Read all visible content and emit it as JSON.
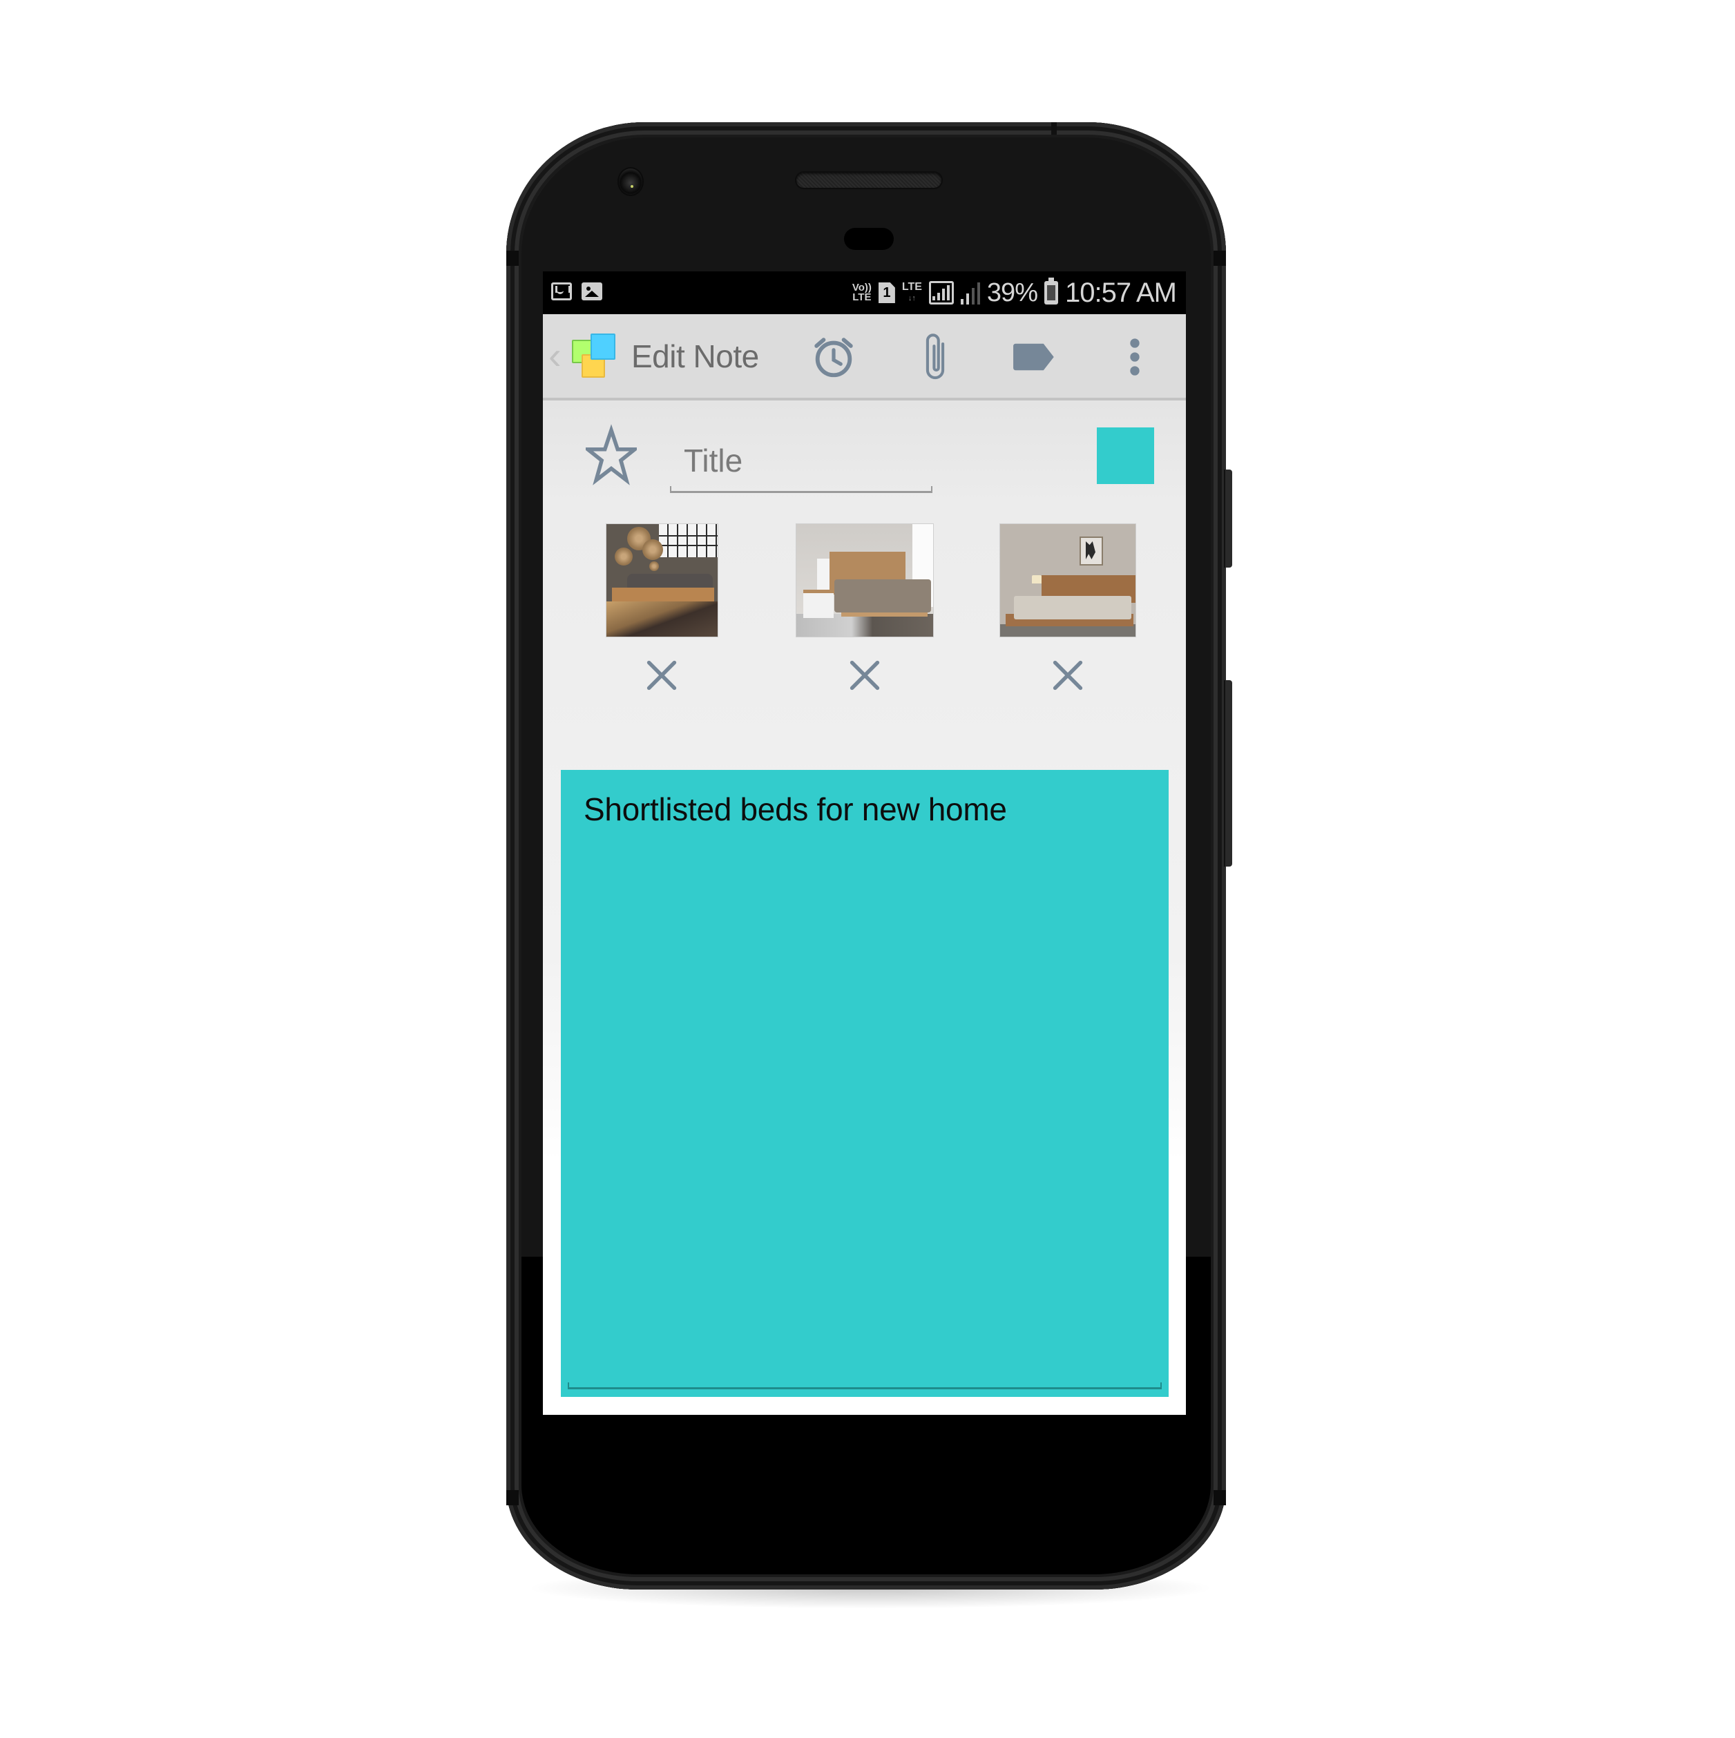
{
  "status_bar": {
    "notification_icons": [
      "gmail-icon",
      "gallery-icon"
    ],
    "volte_label": "Vo)) LTE",
    "sim_slot": "1",
    "network_label": "LTE",
    "battery_percent": "39%",
    "battery_level": 0.39,
    "time": "10:57 AM"
  },
  "toolbar": {
    "back_glyph": "‹",
    "title": "Edit Note",
    "actions": [
      {
        "name": "reminder",
        "icon": "alarm-clock-icon"
      },
      {
        "name": "attach",
        "icon": "paperclip-icon"
      },
      {
        "name": "label",
        "icon": "tag-icon"
      },
      {
        "name": "more",
        "icon": "more-vertical-icon"
      }
    ]
  },
  "editor": {
    "favorite_icon": "star-outline-icon",
    "title_placeholder": "Title",
    "title_value": "",
    "note_color": "#33CCCC",
    "attachments": [
      {
        "name": "bed-image-1",
        "description": "Rustic wooden bed with dark bedding and woven wall baskets"
      },
      {
        "name": "bed-image-2",
        "description": "Modern bed with wooden headboard and white nightstands"
      },
      {
        "name": "bed-image-3",
        "description": "Platform wooden bed with grey bedding and wall art"
      }
    ],
    "remove_glyph": "×",
    "body_text": "Shortlisted beds for new home"
  },
  "colors": {
    "toolbar_bg": "#DCDCDC",
    "icon_tint": "#768798",
    "note_bg": "#33CCCC",
    "status_bar_bg": "#000000"
  }
}
